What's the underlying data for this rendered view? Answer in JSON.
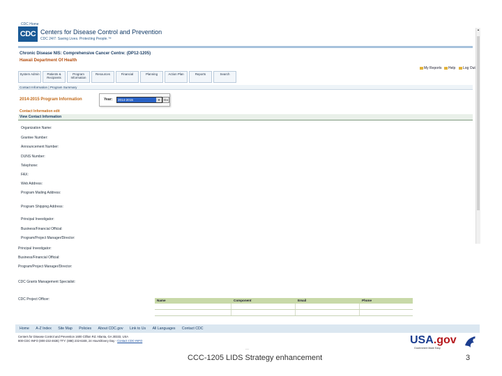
{
  "header": {
    "cdc_home": "CDC Home",
    "logo_text": "CDC",
    "org_name": "Centers for Disease Control and Prevention",
    "tagline": "CDC 24/7: Saving Lives. Protecting People.™"
  },
  "program": {
    "title": "Chronic Disease NIS: Comprehensive Cancer Centre: (DP12-1205)",
    "department": "Hawaii Department Of Health"
  },
  "utility_links": {
    "my_reports": "My Reports",
    "help": "Help",
    "log_out": "Log Out"
  },
  "nav": {
    "tabs": [
      {
        "label": "System Admin"
      },
      {
        "label": "Patients & Recipients"
      },
      {
        "label": "Program Information"
      },
      {
        "label": "Resources"
      },
      {
        "label": "Financial"
      },
      {
        "label": "Planning"
      },
      {
        "label": "Action Plan"
      },
      {
        "label": "Reports"
      },
      {
        "label": "Search"
      }
    ]
  },
  "breadcrumb": "Contact Information | Program Summary",
  "section": {
    "heading": "2014-2015 Program Information",
    "year_label": "Year:",
    "year_value": "2014-2015",
    "go_label": "Go",
    "contact_edit": "Contact Information edit",
    "view_contact": "View Contact Information"
  },
  "fields": [
    {
      "label": "Organization Name:"
    },
    {
      "label": "Grantee Number:"
    },
    {
      "label": "Announcement Number:"
    },
    {
      "label": "DUNS Number:"
    },
    {
      "label": "Telephone:"
    },
    {
      "label": "FAX:"
    },
    {
      "label": "Web Address:"
    },
    {
      "label": "Program Mailing Address:"
    },
    {
      "label": "Program Shipping Address:"
    },
    {
      "label": "Principal Investigator:"
    },
    {
      "label": "Business/Financial Official:"
    },
    {
      "label": "Program/Project Manager/Director:"
    },
    {
      "label": "Principal Investigator:"
    },
    {
      "label": "Business/Financial Official:"
    },
    {
      "label": "Program/Project Manager/Director:"
    },
    {
      "label": "CDC Grants Management Specialist:"
    },
    {
      "label": "CDC Project Officer:"
    }
  ],
  "officer_table": {
    "columns": [
      "Name",
      "Component",
      "Email",
      "Phone"
    ]
  },
  "footer": {
    "links": [
      "Home",
      "A-Z Index",
      "Site Map",
      "Policies",
      "About CDC.gov",
      "Link to Us",
      "All Languages",
      "Contact CDC"
    ],
    "address_line1": "Centers for Disease Control and Prevention   1600 Clifton Rd. Atlanta, GA 30333, USA",
    "address_line2": "800-CDC-INFO (800-232-4636) TTY: (888) 232-6348, 24 Hours/Every Day -",
    "contact_link": "Contact CDC-INFO",
    "usa_gov": "USA",
    "usa_gov_suffix": ".gov",
    "usa_sub": "Government Made Easy"
  },
  "slide": {
    "dots": "...",
    "caption": "CCC-1205 LIDS Strategy enhancement",
    "number": "3"
  },
  "colors": {
    "brand_blue": "#1a5a96",
    "accent_orange": "#c26a1a",
    "table_header_green": "#c8d9a8"
  }
}
